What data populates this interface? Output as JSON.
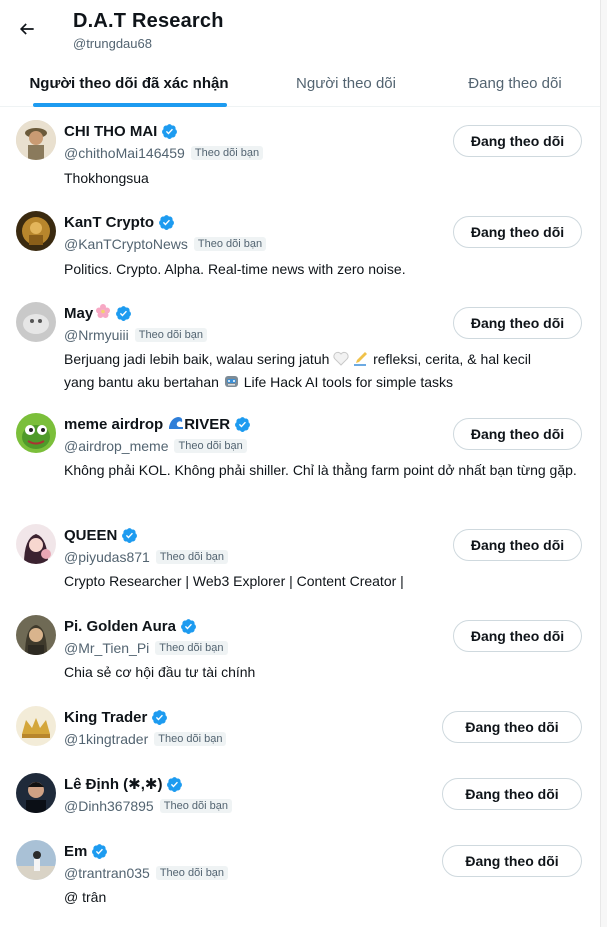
{
  "header": {
    "title": "D.A.T Research",
    "handle": "@trungdau68"
  },
  "tabs": [
    {
      "label": "Người theo dõi đã xác nhận"
    },
    {
      "label": "Người theo dõi"
    },
    {
      "label": "Đang theo dõi"
    }
  ],
  "follow_label": "Đang theo dõi",
  "follows_you_label": "Theo dõi bạn",
  "users": [
    {
      "name": "CHI THO MAI",
      "handle": "@chithoMai146459",
      "bio": "Thokhongsua"
    },
    {
      "name": "KanT Crypto",
      "handle": "@KanTCryptoNews",
      "bio": "Politics. Crypto. Alpha. Real-time news with zero noise."
    },
    {
      "name": "May",
      "handle": "@Nrmyuiii",
      "bio_1": "Berjuang jadi lebih baik, walau sering jatuh",
      "bio_2": "refleksi, cerita, & hal kecil",
      "bio_3": "yang bantu aku bertahan",
      "bio_4": "Life Hack AI tools for simple tasks"
    },
    {
      "name_1": "meme airdrop",
      "name_2": "RIVER",
      "handle": "@airdrop_meme",
      "bio": "Không phải KOL. Không phải shiller. Chỉ là thằng farm point dở nhất bạn từng gặp."
    },
    {
      "name": "QUEEN",
      "handle": "@piyudas871",
      "bio": "Crypto Researcher | Web3 Explorer | Content Creator |"
    },
    {
      "name": "Pi. Golden Aura",
      "handle": "@Mr_Tien_Pi",
      "bio": "Chia sẻ cơ hội đầu tư tài chính"
    },
    {
      "name": "King Trader",
      "handle": "@1kingtrader",
      "bio": ""
    },
    {
      "name": "Lê Định (✱,✱)",
      "handle": "@Dinh367895",
      "bio": ""
    },
    {
      "name": "Em",
      "handle": "@trantran035",
      "bio": "@ trân"
    }
  ],
  "colors": {
    "accent": "#1d9bf0",
    "text": "#0f1419",
    "muted": "#536471"
  }
}
